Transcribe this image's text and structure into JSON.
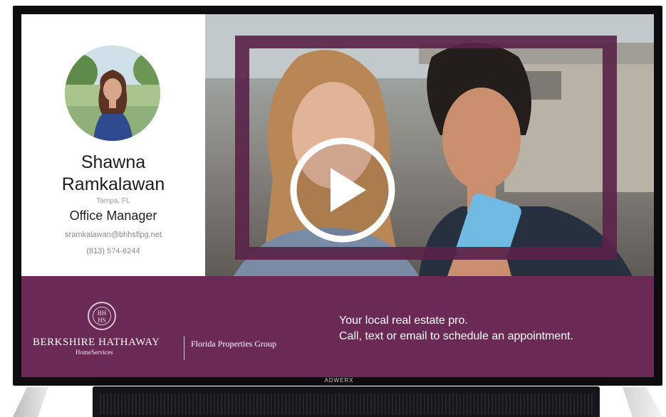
{
  "agent": {
    "first_name": "Shawna",
    "last_name": "Ramkalawan",
    "location": "Tampa, FL",
    "title": "Office Manager",
    "email": "sramkalawan@bhhsflpg.net",
    "phone": "(813) 574-6244"
  },
  "video": {
    "play_icon": "play-icon"
  },
  "band": {
    "company_name": "BERKSHIRE HATHAWAY",
    "company_sub": "HomeServices",
    "region": "Florida Properties Group",
    "seal_text_top": "BH",
    "seal_text_bottom": "HS",
    "tagline_line1": "Your local real estate pro.",
    "tagline_line2": "Call, text or email to schedule an appointment."
  },
  "device": {
    "brand": "ADWERX"
  },
  "colors": {
    "brand_purple": "#6a2a55",
    "frame_purple": "#5a2449"
  }
}
